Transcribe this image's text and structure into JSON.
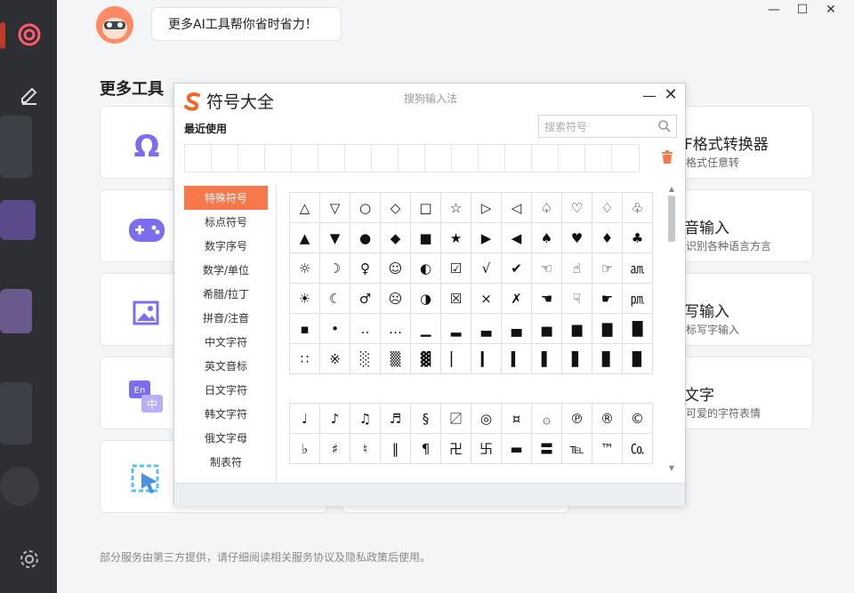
{
  "app": {
    "bubble_text": "更多AI工具帮你省时省力！",
    "section_title": "更多工具",
    "footer": "部分服务由第三方提供，请仔细阅读相关服务协议及隐私政策后使用。"
  },
  "right_cards": [
    {
      "title": "F格式转换器",
      "subtitle": "格式任意转"
    },
    {
      "title": "音输入",
      "subtitle": "识别各种语言方言"
    },
    {
      "title": "写输入",
      "subtitle": "标写字输入"
    },
    {
      "title": "文字",
      "subtitle": "可爱的字符表情"
    }
  ],
  "dialog": {
    "title": "符号大全",
    "ime_name": "搜狗输入法",
    "minimize": "—",
    "close": "✕",
    "recent_label": "最近使用",
    "search_placeholder": "搜索符号",
    "categories": [
      "特殊符号",
      "标点符号",
      "数字序号",
      "数学/单位",
      "希腊/拉丁",
      "拼音/注音",
      "中文字符",
      "英文音标",
      "日文字符",
      "韩文字符",
      "俄文字母",
      "制表符"
    ],
    "active_category": 0,
    "symbols_a": [
      [
        "△",
        "▽",
        "○",
        "◇",
        "□",
        "☆",
        "▷",
        "◁",
        "♤",
        "♡",
        "♢",
        "♧"
      ],
      [
        "▲",
        "▼",
        "●",
        "◆",
        "■",
        "★",
        "▶",
        "◀",
        "♠",
        "♥",
        "♦",
        "♣"
      ],
      [
        "☼",
        "☽",
        "♀",
        "☺",
        "◐",
        "☑",
        "√",
        "✔",
        "☜",
        "☝",
        "☞",
        "㏂"
      ],
      [
        "☀",
        "☾",
        "♂",
        "☹",
        "◑",
        "☒",
        "×",
        "✗",
        "☚",
        "☟",
        "☛",
        "㏘"
      ],
      [
        "▪",
        "•",
        "‥",
        "…",
        "▁",
        "▂",
        "▃",
        "▄",
        "▅",
        "▆",
        "▇",
        "█"
      ],
      [
        "∷",
        "※",
        "░",
        "▒",
        "▓",
        "▏",
        "▎",
        "▍",
        "▌",
        "▋",
        "▊",
        "▉"
      ]
    ],
    "symbols_b": [
      [
        "♩",
        "♪",
        "♫",
        "♬",
        "§",
        "〼",
        "◎",
        "¤",
        "۞",
        "℗",
        "®",
        "©"
      ],
      [
        "♭",
        "♯",
        "♮",
        "‖",
        "¶",
        "卍",
        "卐",
        "▬",
        "〓",
        "℡",
        "™",
        "㏇"
      ]
    ]
  },
  "colors": {
    "accent": "#f7784a",
    "card_icon": "#7c6cf0",
    "left_strip": "#2d2f33"
  }
}
